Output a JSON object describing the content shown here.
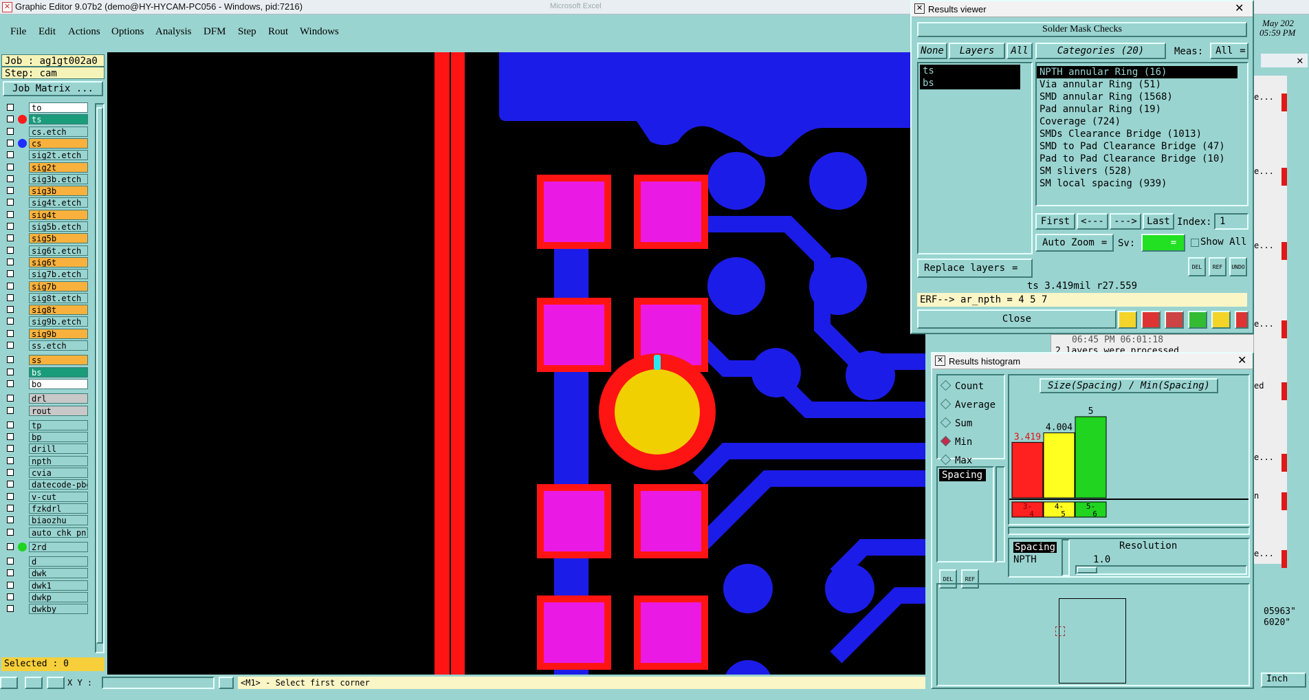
{
  "app": {
    "title": "Graphic Editor 9.07b2 (demo@HY-HYCAM-PC056 - Windows, pid:7216)",
    "bg_title": "Microsoft Excel"
  },
  "menu": [
    "File",
    "Edit",
    "Actions",
    "Options",
    "Analysis",
    "DFM",
    "Step",
    "Rout",
    "Windows"
  ],
  "job": {
    "job": "Job : ag1gt002a0",
    "step": "Step: cam",
    "matrix_button": "Job Matrix ..."
  },
  "layers": [
    {
      "name": "to",
      "bg": "#ffffff",
      "dot": ""
    },
    {
      "name": "ts",
      "bg": "#1a9b7a",
      "dot": "#ff1a1a"
    },
    {
      "name": "cs.etch",
      "bg": "#9ad4d0",
      "dot": ""
    },
    {
      "name": "cs",
      "bg": "#f9b13d",
      "dot": "#1e2fff"
    },
    {
      "name": "sig2t.etch",
      "bg": "#9ad4d0",
      "dot": ""
    },
    {
      "name": "sig2t",
      "bg": "#f9b13d",
      "dot": ""
    },
    {
      "name": "sig3b.etch",
      "bg": "#9ad4d0",
      "dot": ""
    },
    {
      "name": "sig3b",
      "bg": "#f9b13d",
      "dot": ""
    },
    {
      "name": "sig4t.etch",
      "bg": "#9ad4d0",
      "dot": ""
    },
    {
      "name": "sig4t",
      "bg": "#f9b13d",
      "dot": ""
    },
    {
      "name": "sig5b.etch",
      "bg": "#9ad4d0",
      "dot": ""
    },
    {
      "name": "sig5b",
      "bg": "#f9b13d",
      "dot": ""
    },
    {
      "name": "sig6t.etch",
      "bg": "#9ad4d0",
      "dot": ""
    },
    {
      "name": "sig6t",
      "bg": "#f9b13d",
      "dot": ""
    },
    {
      "name": "sig7b.etch",
      "bg": "#9ad4d0",
      "dot": ""
    },
    {
      "name": "sig7b",
      "bg": "#f9b13d",
      "dot": ""
    },
    {
      "name": "sig8t.etch",
      "bg": "#9ad4d0",
      "dot": ""
    },
    {
      "name": "sig8t",
      "bg": "#f9b13d",
      "dot": ""
    },
    {
      "name": "sig9b.etch",
      "bg": "#9ad4d0",
      "dot": ""
    },
    {
      "name": "sig9b",
      "bg": "#f9b13d",
      "dot": ""
    },
    {
      "name": "ss.etch",
      "bg": "#9ad4d0",
      "dot": ""
    },
    {
      "name": "ss",
      "bg": "#f9b13d",
      "dot": ""
    },
    {
      "name": "bs",
      "bg": "#1a9b7a",
      "dot": ""
    },
    {
      "name": "bo",
      "bg": "#ffffff",
      "dot": ""
    },
    {
      "name": "drl",
      "bg": "#c8c8c8",
      "dot": ""
    },
    {
      "name": "rout",
      "bg": "#c8c8c8",
      "dot": ""
    },
    {
      "name": "tp",
      "bg": "#9ad4d0",
      "dot": ""
    },
    {
      "name": "bp",
      "bg": "#9ad4d0",
      "dot": ""
    },
    {
      "name": "drill",
      "bg": "#9ad4d0",
      "dot": ""
    },
    {
      "name": "npth",
      "bg": "#9ad4d0",
      "dot": ""
    },
    {
      "name": "cvia",
      "bg": "#9ad4d0",
      "dot": ""
    },
    {
      "name": "datecode-pbe",
      "bg": "#9ad4d0",
      "dot": ""
    },
    {
      "name": "v-cut",
      "bg": "#9ad4d0",
      "dot": ""
    },
    {
      "name": "fzkdrl",
      "bg": "#9ad4d0",
      "dot": ""
    },
    {
      "name": "biaozhu",
      "bg": "#9ad4d0",
      "dot": ""
    },
    {
      "name": "auto_chk_pnl",
      "bg": "#9ad4d0",
      "dot": ""
    },
    {
      "name": "2rd",
      "bg": "#9ad4d0",
      "dot": "#1fd41f"
    },
    {
      "name": "d",
      "bg": "#9ad4d0",
      "dot": ""
    },
    {
      "name": "dwk",
      "bg": "#9ad4d0",
      "dot": ""
    },
    {
      "name": "dwk1",
      "bg": "#9ad4d0",
      "dot": ""
    },
    {
      "name": "dwkp",
      "bg": "#9ad4d0",
      "dot": ""
    },
    {
      "name": "dwkby",
      "bg": "#9ad4d0",
      "dot": ""
    }
  ],
  "selected": "Selected : 0",
  "bottom": {
    "xy_label": "X Y :",
    "status": "<M1> - Select first corner"
  },
  "results_viewer": {
    "title": "Results viewer",
    "heading": "Solder Mask Checks",
    "none_btn": "None",
    "layers_btn": "Layers",
    "all_btn": "All",
    "layers_list": [
      "ts",
      "bs"
    ],
    "categories_label": "Categories (20)",
    "meas_label": "Meas:",
    "meas_value": "All",
    "categories": [
      "NPTH annular Ring (16)",
      "Via annular Ring (51)",
      "SMD annular Ring (1568)",
      "Pad annular Ring (19)",
      "Coverage (724)",
      "SMDs Clearance Bridge (1013)",
      "SMD to Pad Clearance Bridge (47)",
      "Pad to Pad Clearance Bridge (10)",
      "SM slivers (528)",
      "SM local spacing (939)"
    ],
    "first": "First",
    "prev": "<---",
    "next": "--->",
    "last": "Last",
    "index_label": "Index:",
    "index_value": "1",
    "auto_zoom": "Auto Zoom",
    "sv_label": "Sv:",
    "show_all": "Show All",
    "replace_layers": "Replace layers",
    "measure": "ts 3.419mil  r27.559",
    "erf": "ERF--> ar_npth = 4 5 7",
    "close": "Close",
    "icon_labels": [
      "DEL",
      "REF",
      "UNDO"
    ]
  },
  "histogram": {
    "title": "Results histogram",
    "modes": [
      "Count",
      "Average",
      "Sum",
      "Min",
      "Max"
    ],
    "selected_mode": "Min",
    "list": [
      "Spacing"
    ],
    "chart_title": "Size(Spacing) / Min(Spacing)",
    "field_name": "Spacing",
    "field_type": "NPTH",
    "resolution_label": "Resolution",
    "resolution_value": "1.0",
    "icon_labels": [
      "DEL",
      "REF"
    ]
  },
  "chart_data": {
    "type": "bar",
    "title": "Size(Spacing) / Min(Spacing)",
    "categories": [
      "3-4",
      "4-5",
      "5-6"
    ],
    "values": [
      3.419,
      4.004,
      5
    ],
    "value_labels": [
      "3.419",
      "4.004",
      "5"
    ],
    "colors": [
      "#ff2020",
      "#ffff20",
      "#20d420"
    ],
    "ylim": [
      0,
      5
    ]
  },
  "bg_window": {
    "log_text": "2 layers were processed",
    "time_text": "06:45 PM        06:01:18",
    "clock_date": "May 202",
    "clock_time": "05:59 PM",
    "side_labels": [
      "e...",
      "e...",
      "e...",
      "e...",
      "ed",
      "e...",
      "n",
      "e..."
    ],
    "coords": [
      "05963\"",
      "6020\""
    ],
    "unit": "Inch"
  }
}
